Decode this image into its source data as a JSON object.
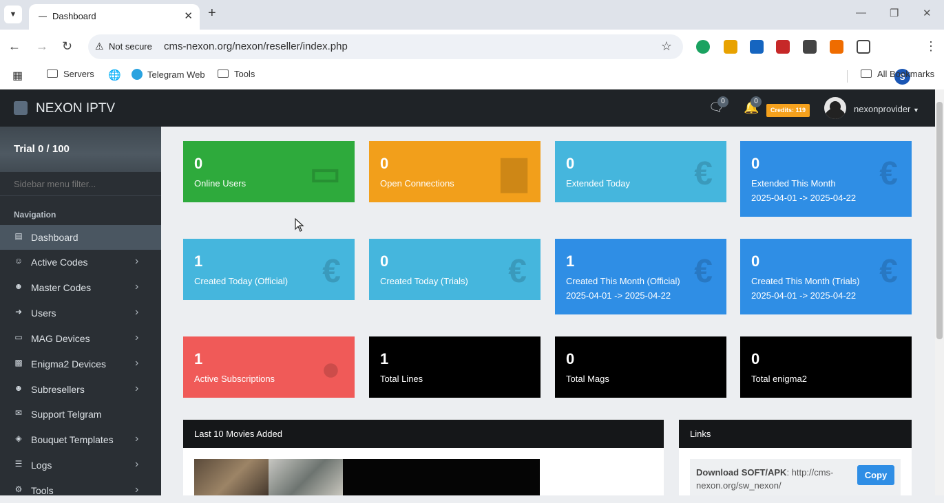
{
  "browser": {
    "tab_title": "Dashboard",
    "new_tab": "+",
    "not_secure": "Not secure",
    "url": "cms-nexon.org/nexon/reseller/index.php",
    "profile_initial": "S",
    "extension_colors": [
      "#1aa260",
      "#e8a200",
      "#1565c0",
      "#c62828",
      "#444444",
      "#ef6c00",
      "#333333"
    ],
    "bookmarks": [
      "Servers",
      "Telegram Web",
      "Tools"
    ],
    "all_bookmarks": "All Bookmarks"
  },
  "topbar": {
    "brand": "NEXON IPTV",
    "messages_count": "0",
    "notifications_count": "0",
    "credits": "Credits: 119",
    "username": "nexonprovider"
  },
  "sidebar": {
    "trial": "Trial 0 / 100",
    "filter_placeholder": "Sidebar menu filter...",
    "nav_heading": "Navigation",
    "items": [
      {
        "label": "Dashboard",
        "icon": "laptop-icon",
        "arrow": false,
        "active": true
      },
      {
        "label": "Active Codes",
        "icon": "user-icon",
        "arrow": true
      },
      {
        "label": "Master Codes",
        "icon": "users-icon",
        "arrow": true
      },
      {
        "label": "Users",
        "icon": "sign-in-icon",
        "arrow": true
      },
      {
        "label": "MAG Devices",
        "icon": "tv-icon",
        "arrow": true
      },
      {
        "label": "Enigma2 Devices",
        "icon": "device-icon",
        "arrow": true
      },
      {
        "label": "Subresellers",
        "icon": "users-icon",
        "arrow": true
      },
      {
        "label": "Support Telgram",
        "icon": "envelope-icon",
        "arrow": false
      },
      {
        "label": "Bouquet Templates",
        "icon": "layers-icon",
        "arrow": true
      },
      {
        "label": "Logs",
        "icon": "list-icon",
        "arrow": true
      },
      {
        "label": "Tools",
        "icon": "gear-icon",
        "arrow": true
      }
    ]
  },
  "cards": [
    {
      "value": "0",
      "label": "Online Users",
      "sub": "",
      "color": "#2eaa3c",
      "icon": "monitor-icon"
    },
    {
      "value": "0",
      "label": "Open Connections",
      "sub": "",
      "color": "#f29f1b",
      "icon": "signal-icon"
    },
    {
      "value": "0",
      "label": "Extended Today",
      "sub": "",
      "color": "#45b6dd",
      "icon": "euro-icon"
    },
    {
      "value": "0",
      "label": "Extended This Month",
      "sub": "2025-04-01 -> 2025-04-22",
      "color": "#2f8ee5",
      "icon": "euro-icon"
    },
    {
      "value": "1",
      "label": "Created Today (Official)",
      "sub": "",
      "color": "#45b6dd",
      "icon": "euro-icon"
    },
    {
      "value": "0",
      "label": "Created Today (Trials)",
      "sub": "",
      "color": "#45b6dd",
      "icon": "euro-icon"
    },
    {
      "value": "1",
      "label": "Created This Month (Official)",
      "sub": "2025-04-01 -> 2025-04-22",
      "color": "#2f8ee5",
      "icon": "euro-icon"
    },
    {
      "value": "0",
      "label": "Created This Month (Trials)",
      "sub": "2025-04-01 -> 2025-04-22",
      "color": "#2f8ee5",
      "icon": "euro-icon"
    },
    {
      "value": "1",
      "label": "Active Subscriptions",
      "sub": "",
      "color": "#f05a58",
      "icon": "person-icon"
    },
    {
      "value": "1",
      "label": "Total Lines",
      "sub": "",
      "color": "#000000",
      "icon": ""
    },
    {
      "value": "0",
      "label": "Total Mags",
      "sub": "",
      "color": "#000000",
      "icon": ""
    },
    {
      "value": "0",
      "label": "Total enigma2",
      "sub": "",
      "color": "#000000",
      "icon": ""
    }
  ],
  "movies_panel": {
    "title": "Last 10 Movies Added"
  },
  "links_panel": {
    "title": "Links",
    "download_label": "Download SOFT/APK",
    "download_url": ": http://cms-nexon.org/sw_nexon/",
    "copy": "Copy"
  }
}
